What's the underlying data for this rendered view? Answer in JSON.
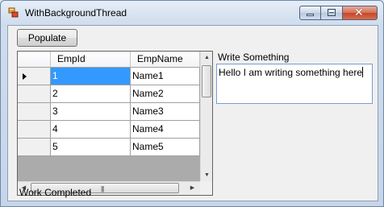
{
  "window": {
    "title": "WithBackgroundThread",
    "icon": "winforms-app-icon"
  },
  "toolbar": {
    "populate_label": "Populate"
  },
  "grid": {
    "columns": [
      "EmpId",
      "EmpName"
    ],
    "rows": [
      {
        "id": "1",
        "name": "Name1",
        "current": true
      },
      {
        "id": "2",
        "name": "Name2"
      },
      {
        "id": "3",
        "name": "Name3"
      },
      {
        "id": "4",
        "name": "Name4"
      },
      {
        "id": "5",
        "name": "Name5"
      }
    ],
    "selection_color": "#3399ff"
  },
  "input": {
    "label": "Write Something",
    "value": "Hello I am writing something here"
  },
  "status": {
    "text": "Work Completed"
  }
}
